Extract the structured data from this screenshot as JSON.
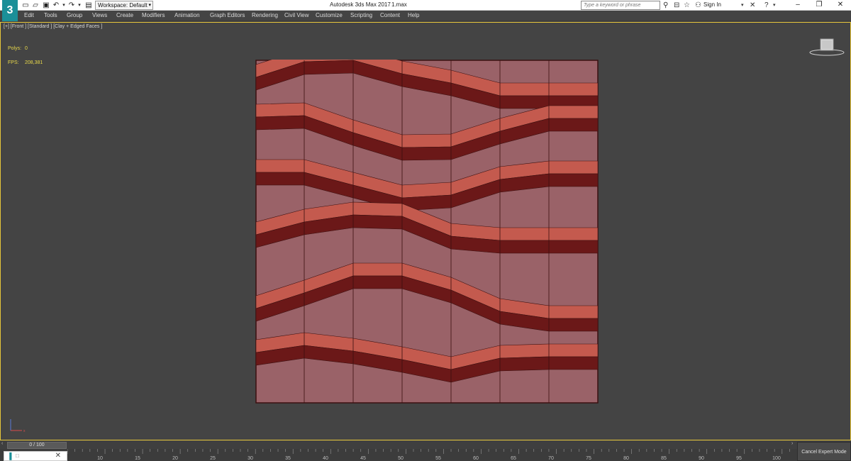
{
  "title_bar": {
    "app_logo": "3",
    "quick_access": [
      "new-file-icon",
      "open-folder-icon",
      "save-icon",
      "undo-icon",
      "dropdown-icon",
      "redo-icon",
      "dropdown-icon",
      "project-icon"
    ],
    "workspace_label": "Workspace: Default",
    "window_title": "Autodesk 3ds Max 2017",
    "file_name": "1.max",
    "search_placeholder": "Type a keyword or phrase",
    "sign_in": "Sign In",
    "window_buttons": [
      "minimize-icon",
      "restore-icon",
      "close-icon"
    ]
  },
  "menu": {
    "items": [
      "Edit",
      "Tools",
      "Group",
      "Views",
      "Create",
      "Modifiers",
      "Animation",
      "Graph Editors",
      "Rendering",
      "Civil View",
      "Customize",
      "Scripting",
      "Content",
      "Help"
    ]
  },
  "viewport": {
    "label": "[+] [Front ] [Standard ] [Clay + Edged Faces ]",
    "stats": [
      {
        "label": "Polys:",
        "value": "0"
      },
      {
        "label": "FPS:",
        "value": "208,381"
      }
    ],
    "colors": {
      "background": "#444444",
      "border": "#e6c63a",
      "plane": "#9a6268",
      "band_light": "#c45a4e",
      "band_dark": "#6b1818",
      "edges": "#3a1010"
    }
  },
  "timeline": {
    "slider_label": "0 / 100",
    "ticks": [
      "10",
      "15",
      "20",
      "25",
      "30",
      "35",
      "40",
      "45",
      "50",
      "55",
      "60",
      "65",
      "70",
      "75",
      "80",
      "85",
      "90",
      "95",
      "100"
    ]
  },
  "status": {
    "expert_button": "Cancel Expert Mode"
  }
}
